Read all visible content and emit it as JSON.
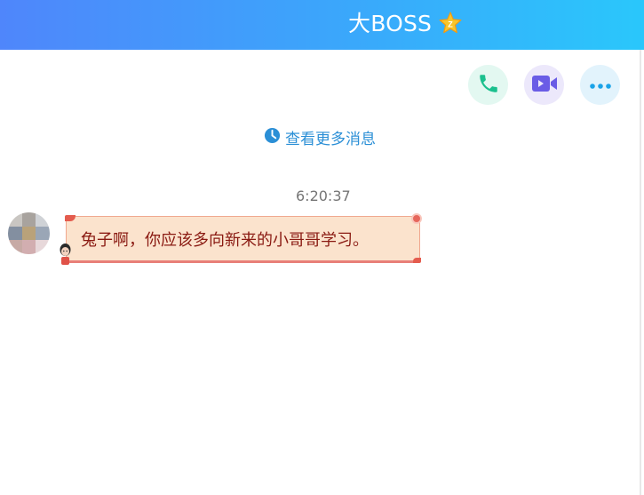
{
  "header": {
    "title": "大BOSS",
    "badge_icon": "gold-star-badge-icon",
    "badge_text": "Z",
    "gradient_start": "#4f86fb",
    "gradient_end": "#2ac7fb"
  },
  "actions": [
    {
      "name": "voice-call-button",
      "icon": "phone-icon",
      "color": "#1bc08e"
    },
    {
      "name": "video-call-button",
      "icon": "video-camera-icon",
      "color": "#6a5ce6"
    },
    {
      "name": "more-button",
      "icon": "more-dots-icon",
      "color": "#1aa3e8"
    }
  ],
  "history": {
    "view_more_label": "查看更多消息",
    "icon": "clock-icon"
  },
  "messages": [
    {
      "timestamp": "6:20:37",
      "sender_avatar": "pixelated-avatar",
      "text": "兔子啊，你应该多向新来的小哥哥学习。",
      "bubble_style": "festive-red-scroll"
    }
  ]
}
